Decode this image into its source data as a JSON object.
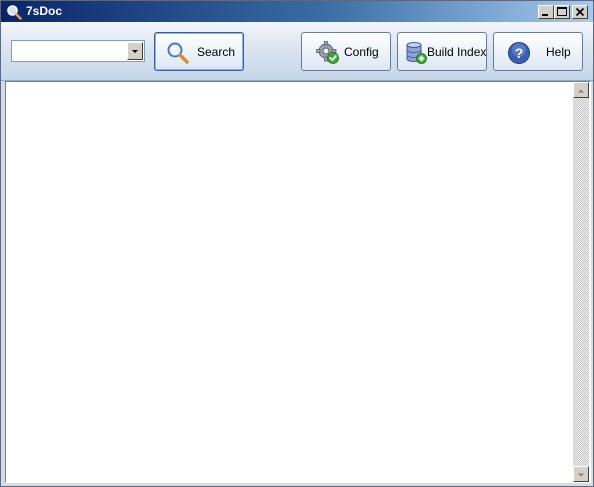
{
  "window": {
    "title": "7sDoc"
  },
  "toolbar": {
    "search_combo": {
      "value": "",
      "placeholder": ""
    },
    "buttons": {
      "search": {
        "label": "Search",
        "icon": "magnifier-icon"
      },
      "config": {
        "label": "Config",
        "icon": "gear-check-icon"
      },
      "build_index": {
        "label": "Build Index",
        "icon": "database-add-icon"
      },
      "help": {
        "label": "Help",
        "icon": "help-icon"
      }
    }
  },
  "colors": {
    "titlebar_start": "#0a246a",
    "titlebar_end": "#a6caf0",
    "toolbar_bg": "#dbe5f1",
    "help_blue": "#3a5fb0"
  }
}
